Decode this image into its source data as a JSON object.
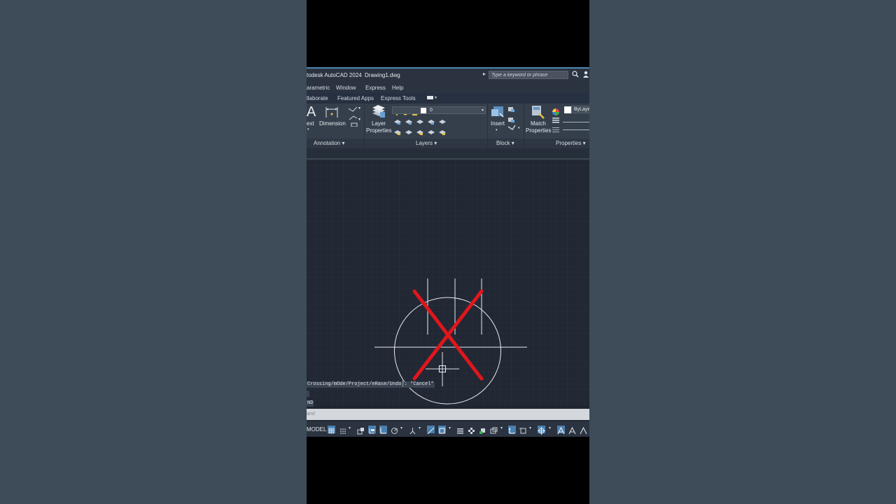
{
  "window": {
    "app_title": "todesk AutoCAD 2024",
    "file_name": "Drawing1.dwg",
    "search_placeholder": "Type a keyword or phrase"
  },
  "menu": [
    "arametric",
    "Window",
    "Express",
    "Help"
  ],
  "ribbon_tabs": [
    "llaborate",
    "Featured Apps",
    "Express Tools"
  ],
  "ribbon": {
    "text_label": "ext",
    "dimension_label": "Dimension",
    "layer_properties_label_1": "Layer",
    "layer_properties_label_2": "Properties",
    "layer_value": "0",
    "insert_label": "Insert",
    "match_properties_label_1": "Match",
    "match_properties_label_2": "Properties",
    "bylayer_value": "ByLaye",
    "panels": {
      "annotation": "Annotation ▾",
      "layers": "Layers ▾",
      "block": "Block ▾",
      "properties": "Properties ▾"
    }
  },
  "command": {
    "history_1": "Crossing/mOde/Project/eRase/Undo]: *Cancel*",
    "history_2": "",
    "history_3": "ND",
    "input_placeholder": "and"
  },
  "status": {
    "model_label": "MODEL"
  },
  "colors": {
    "accent_blue": "#4a7fae",
    "cross_red": "#e0161c",
    "canvas_bg": "#212833"
  },
  "icons": [
    "search-icon",
    "user-icon",
    "grid-icon",
    "snap-icon",
    "ortho-icon",
    "polar-icon",
    "osnap-icon",
    "lineweight-icon",
    "annotation-scale-icon"
  ]
}
